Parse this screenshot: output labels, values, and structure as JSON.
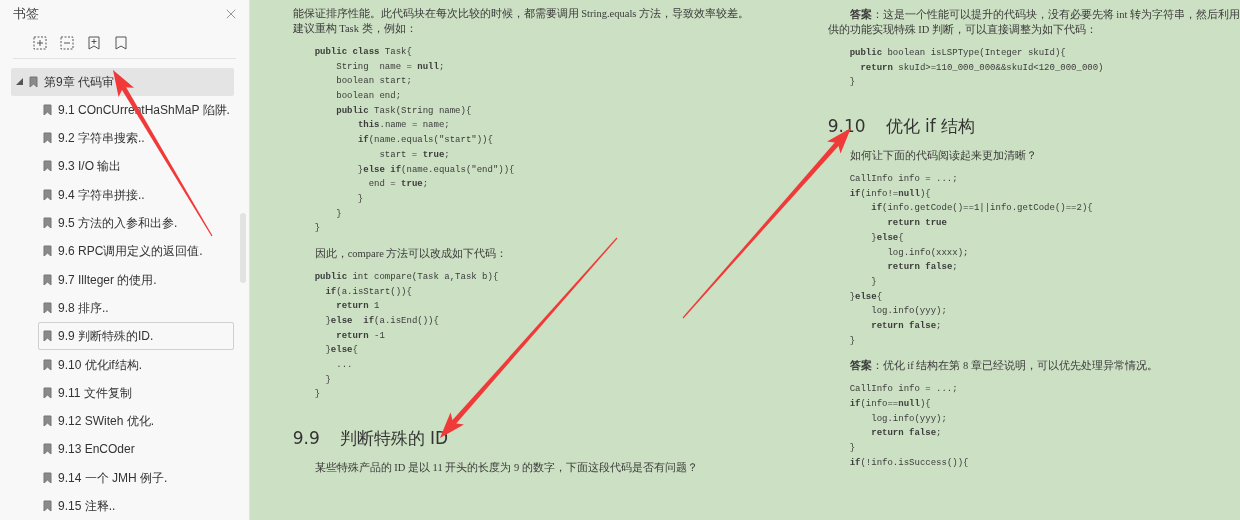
{
  "sidebar": {
    "title": "书签",
    "bookmarks": [
      {
        "label": "第9章 代码审",
        "expanded": true,
        "selected": true,
        "focused": false,
        "children": [
          {
            "label": "9.1 COnCUrrentHaShMaP 陷阱.",
            "selected": false,
            "focused": false
          },
          {
            "label": "9.2 字符串搜索..",
            "selected": false,
            "focused": false
          },
          {
            "label": "9.3 I/O 输出",
            "selected": false,
            "focused": false
          },
          {
            "label": "9.4 字符串拼接..",
            "selected": false,
            "focused": false
          },
          {
            "label": "9.5 方法的入参和出参.",
            "selected": false,
            "focused": false
          },
          {
            "label": "9.6 RPC调用定义的返回值.",
            "selected": false,
            "focused": false
          },
          {
            "label": "9.7 Illteger 的使用.",
            "selected": false,
            "focused": false
          },
          {
            "label": "9.8 排序..",
            "selected": false,
            "focused": false
          },
          {
            "label": "9.9 判断特殊的ID.",
            "selected": false,
            "focused": true
          },
          {
            "label": "9.10 优化if结构.",
            "selected": false,
            "focused": false
          },
          {
            "label": "9.11 文件复制",
            "selected": false,
            "focused": false
          },
          {
            "label": "9.12 SWiteh 优化.",
            "selected": false,
            "focused": false
          },
          {
            "label": "9.13 EnCOder",
            "selected": false,
            "focused": false
          },
          {
            "label": "9.14 一个 JMH 例子.",
            "selected": false,
            "focused": false
          },
          {
            "label": "9.15 注释..",
            "selected": false,
            "focused": false
          }
        ]
      }
    ]
  },
  "document": {
    "pages": [
      {
        "blocks": [
          {
            "kind": "paragraph",
            "indented": false,
            "lines": [
              "能保证排序性能。此代码块在每次比较的时候，都需要调用 String.equals 方法，导致效率较差。",
              "建议重构 Task 类，例如："
            ]
          },
          {
            "kind": "code",
            "lines": [
              "**public class** Task{",
              "    String  name = **null**;",
              "    boolean start;",
              "    boolean end;",
              "    **public** Task(String name){",
              "        **this**.name = name;",
              "        **if**(name.equals(\"start\")){",
              "            start = **true**;",
              "        }**else if**(name.equals(\"end\")){",
              "          end = **true**;",
              "        }",
              "    }",
              "}"
            ]
          },
          {
            "kind": "paragraph",
            "indented": true,
            "lines": [
              "因此，compare 方法可以改成如下代码："
            ]
          },
          {
            "kind": "code",
            "lines": [
              "**public** int compare(Task a,Task b){",
              "  **if**(a.isStart()){",
              "    **return** 1",
              "  }**else**  **if**(a.isEnd()){",
              "    **return** -1",
              "  }**else**{",
              "    ...",
              "  }",
              "}"
            ]
          },
          {
            "kind": "heading",
            "number": "9.9",
            "title": "判断特殊的 ID"
          },
          {
            "kind": "paragraph",
            "indented": true,
            "lines": [
              "某些特殊产品的 ID 是以 11 开头的长度为 9 的数字，下面这段代码是否有问题？"
            ]
          }
        ]
      },
      {
        "blocks": [
          {
            "kind": "paragraph",
            "indented": true,
            "lines": [
              "**答案**：这是一个性能可以提升的代码块，没有必要先将 int 转为字符串，然后利用",
              "供的功能实现特殊 ID 判断，可以直接调整为如下代码："
            ]
          },
          {
            "kind": "code",
            "lines": [
              "**public** boolean isLSPType(Integer skuId){",
              "  **return** skuId>=110_000_000&&skuId<120_000_000)",
              "}"
            ]
          },
          {
            "kind": "heading",
            "number": "9.10",
            "title": "优化 if 结构"
          },
          {
            "kind": "paragraph",
            "indented": true,
            "lines": [
              "如何让下面的代码阅读起来更加清晰？"
            ]
          },
          {
            "kind": "code",
            "lines": [
              "CallInfo info = ...;",
              "**if**(info!=**null**){",
              "    **if**(info.getCode()==1||info.getCode()==2){",
              "       **return true**",
              "    }**else**{",
              "       log.info(xxxx);",
              "       **return false**;",
              "    }",
              "}**else**{",
              "    log.info(yyy);",
              "    **return false**;",
              "}"
            ]
          },
          {
            "kind": "paragraph",
            "indented": true,
            "lines": [
              "**答案**：优化 if 结构在第 8 章已经说明，可以优先处理异常情况。"
            ]
          },
          {
            "kind": "code",
            "lines": [
              "CallInfo info = ...;",
              "**if**(info==**null**){",
              "    log.info(yyy);",
              "    **return false**;",
              "}",
              "**if**(!info.isSuccess()){"
            ]
          }
        ]
      }
    ]
  }
}
